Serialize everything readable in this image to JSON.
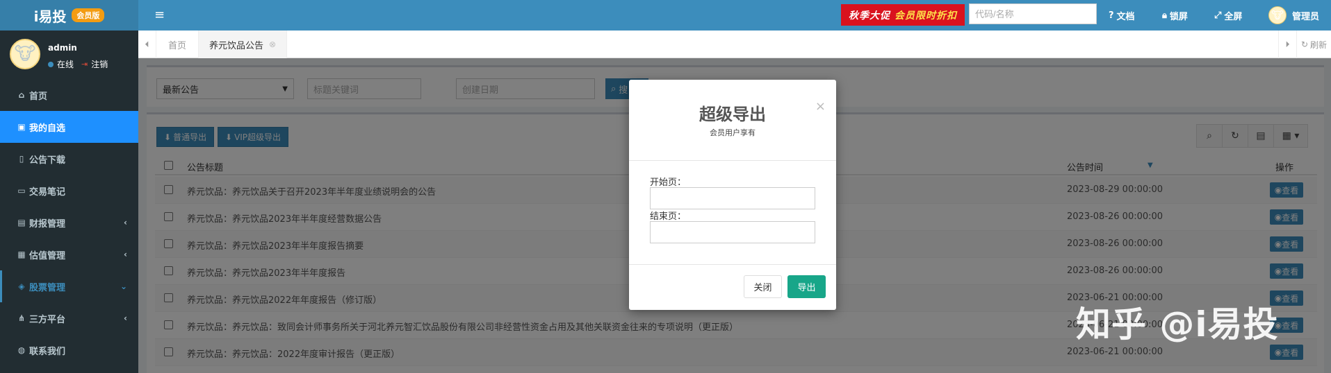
{
  "app": {
    "logo_text": "i易投",
    "logo_badge": "会员版",
    "promo_main": "秋季大促",
    "promo_accent": "会员限时折扣",
    "search_placeholder": "代码/名称",
    "nav_docs": "文档",
    "nav_lock": "锁屏",
    "nav_fullscreen": "全屏",
    "nav_user": "管理员"
  },
  "sidebar": {
    "user": {
      "name": "admin",
      "status": "在线",
      "logout": "注销"
    },
    "items": [
      {
        "label": "首页",
        "icon": "home-icon"
      },
      {
        "label": "我的自选",
        "icon": "bookmark-icon",
        "active": true
      },
      {
        "label": "公告下载",
        "icon": "map-icon"
      },
      {
        "label": "交易笔记",
        "icon": "folder-icon"
      },
      {
        "label": "财报管理",
        "icon": "book-icon",
        "arrow": "‹"
      },
      {
        "label": "估值管理",
        "icon": "calculator-icon",
        "arrow": "‹"
      },
      {
        "label": "股票管理",
        "icon": "cube-icon",
        "arrow": "⌄",
        "open": true
      },
      {
        "label": "三方平台",
        "icon": "share-icon",
        "arrow": "‹"
      },
      {
        "label": "联系我们",
        "icon": "chat-icon"
      }
    ]
  },
  "tabs": [
    {
      "label": "首页"
    },
    {
      "label": "养元饮品公告",
      "active": true
    }
  ],
  "tabs_refresh": "刷新",
  "filters": {
    "type_value": "最新公告",
    "keyword_placeholder": "标题关键词",
    "date_placeholder": "创建日期",
    "search_label": "搜"
  },
  "toolbar": {
    "normal_export": "普通导出",
    "vip_export": "VIP超级导出"
  },
  "table": {
    "col_title": "公告标题",
    "col_time": "公告时间",
    "col_action": "操作",
    "view_label": "查看",
    "rows": [
      {
        "title": "养元饮品：养元饮品关于召开2023年半年度业绩说明会的公告",
        "time": "2023-08-29 00:00:00"
      },
      {
        "title": "养元饮品：养元饮品2023年半年度经营数据公告",
        "time": "2023-08-26 00:00:00"
      },
      {
        "title": "养元饮品：养元饮品2023年半年度报告摘要",
        "time": "2023-08-26 00:00:00"
      },
      {
        "title": "养元饮品：养元饮品2023年半年度报告",
        "time": "2023-08-26 00:00:00"
      },
      {
        "title": "养元饮品：养元饮品2022年年度报告（修订版）",
        "time": "2023-06-21 00:00:00"
      },
      {
        "title": "养元饮品：养元饮品：致同会计师事务所关于河北养元智汇饮品股份有限公司非经营性资金占用及其他关联资金往来的专项说明（更正版）",
        "time": "2023-06-21 00:00:00"
      },
      {
        "title": "养元饮品：养元饮品：2022年度审计报告（更正版）",
        "time": "2023-06-21 00:00:00"
      }
    ]
  },
  "modal": {
    "title": "超级导出",
    "subtitle": "会员用户享有",
    "start_label": "开始页：",
    "end_label": "结束页：",
    "close_label": "关闭",
    "export_label": "导出"
  },
  "watermark": "知乎 @i易投"
}
